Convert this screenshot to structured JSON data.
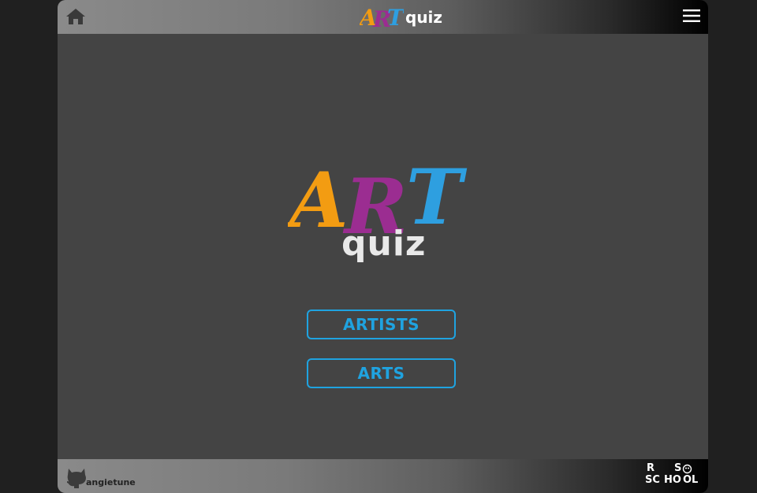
{
  "header": {
    "logo_art": [
      "A",
      "R",
      "T"
    ],
    "logo_word": "quiz",
    "home_icon": "home-icon",
    "menu_icon": "hamburger-menu-icon"
  },
  "main": {
    "logo_art": [
      "A",
      "R",
      "T"
    ],
    "logo_word": "quiz",
    "categories": [
      {
        "label": "ARTISTS"
      },
      {
        "label": "ARTS"
      }
    ]
  },
  "footer": {
    "github_user": "angietune",
    "github_icon": "github-icon",
    "school_logo": {
      "line1": [
        "R",
        "S"
      ],
      "line2": [
        "SC",
        "HO",
        "OL"
      ]
    }
  },
  "colors": {
    "background": "#202020",
    "app_background": "#444444",
    "accent": "#1fa3e0",
    "logo_a": "#f39c12",
    "logo_r": "#9b2d91",
    "logo_t": "#2e9fe0",
    "logo_word": "#e9e9e9"
  }
}
